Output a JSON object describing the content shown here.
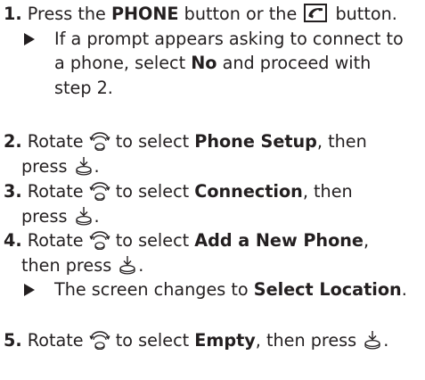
{
  "steps": [
    {
      "number": "1.",
      "t1": " Press the ",
      "b1": "PHONE",
      "t2": " button or the ",
      "t3": " button.",
      "note_line1": "If a prompt appears asking to connect to",
      "note_line2_a": "a phone, select ",
      "note_line2_b": "No",
      "note_line2_c": " and proceed with",
      "note_line3": "step 2."
    },
    {
      "number": "2.",
      "t1": " Rotate ",
      "t2": " to select ",
      "b1": "Phone Setup",
      "t3": ", then",
      "t4": "press ",
      "t5": "."
    },
    {
      "number": "3.",
      "t1": " Rotate ",
      "t2": " to select ",
      "b1": "Connection",
      "t3": ", then",
      "t4": "press ",
      "t5": "."
    },
    {
      "number": "4.",
      "t1": " Rotate ",
      "t2": " to select ",
      "b1": "Add a New Phone",
      "t3": ",",
      "t4": "then press ",
      "t5": ".",
      "note_a": "The screen changes to ",
      "note_b": "Select Location",
      "note_c": "."
    },
    {
      "number": "5.",
      "t1": " Rotate ",
      "t2": " to select ",
      "b1": "Empty",
      "t3": ", then press ",
      "t4": "."
    }
  ],
  "icons": {
    "rotate": "interface-dial-rotate-icon",
    "press": "interface-dial-press-icon",
    "phone_button": "phone-handset-button-icon",
    "bullet": "triangle-bullet-icon"
  },
  "colors": {
    "text": "#231f20",
    "background": "#ffffff"
  }
}
